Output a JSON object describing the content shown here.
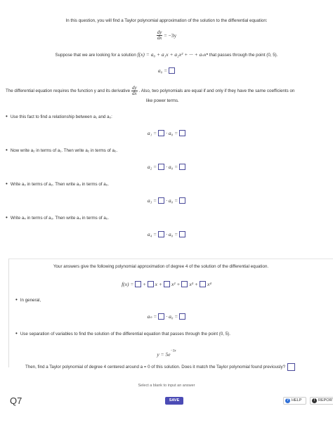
{
  "intro": "In this question, you will find a Taylor polynomial approximation of the solution to the differential equation:",
  "de": {
    "num": "dy",
    "den": "dx",
    "rhs": "= −3y"
  },
  "suppose": {
    "pre": "Suppose that we are looking for a solution",
    "series": "f(x) = a₀ + a₁x + a₂x² + ··· + aₙxⁿ",
    "post": "that passes through the point (0, 5)."
  },
  "a0_label": "a₀ =",
  "requires": {
    "pre": "The differential equation requires the function y and its derivative",
    "num": "dy",
    "den": "dx",
    "post": ". Also, two polynomials are equal if and only if they have the same coefficients on",
    "line2": "like power terms."
  },
  "bullets": [
    "Use this fact to find a relationship between a₁ and a₀:",
    "Now write a₂ in terms of a₁. Then write a₂ in terms of a₀.",
    "Write a₃ in terms of a₂. Then write a₃ in terms of a₀.",
    "Write a₄ in terms of a₃. Then write a₄ in terms of a₀."
  ],
  "rel_rows": [
    {
      "lhs": "a₁ =",
      "mid": "· a₀ ="
    },
    {
      "lhs": "a₂ =",
      "mid": "· a₀ ="
    },
    {
      "lhs": "a₃ =",
      "mid": "· a₀ ="
    },
    {
      "lhs": "a₄ =",
      "mid": "· a₀ ="
    }
  ],
  "approx_text": "Your answers give the following polynomial approximation of degree 4 of the solution of the differential equation.",
  "poly": {
    "lhs": "f(x) =",
    "plus": "+",
    "terms": [
      "x +",
      "x² +",
      "x³ +",
      "x⁴"
    ]
  },
  "in_general": "In general,",
  "an_row": {
    "lhs": "aₙ =",
    "mid": "· a₀ ="
  },
  "separation": "Use separation of variables to find the solution of the differential equation that passes through the point (0, 5).",
  "solution": "y = 5e",
  "solution_exp": "−3x",
  "then_text": "Then, find a Taylor polynomial of degree 4 centered around a = 0 of this solution. Does it match the Taylor polynomial found previously?",
  "hint": "Select a blank to input an answer",
  "question_label": "Q7",
  "buttons": {
    "save": "SAVE",
    "help": "HELP",
    "report": "REPORT"
  },
  "colors": {
    "accent": "#4b4bb5",
    "help_icon": "#2f6fd6",
    "report_icon": "#333333"
  }
}
